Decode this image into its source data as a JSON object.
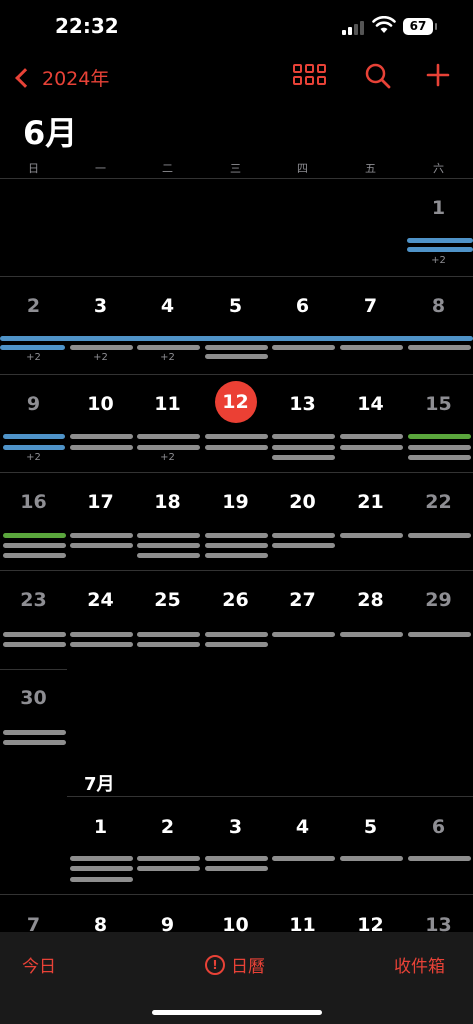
{
  "status": {
    "time": "22:32",
    "battery": "67"
  },
  "nav": {
    "back_label": "2024年"
  },
  "month_title": "6月",
  "weekdays": [
    "日",
    "一",
    "二",
    "三",
    "四",
    "五",
    "六"
  ],
  "june_weeks": [
    [
      "",
      "",
      "",
      "",
      "",
      "",
      "1"
    ],
    [
      "2",
      "3",
      "4",
      "5",
      "6",
      "7",
      "8"
    ],
    [
      "9",
      "10",
      "11",
      "12",
      "13",
      "14",
      "15"
    ],
    [
      "16",
      "17",
      "18",
      "19",
      "20",
      "21",
      "22"
    ],
    [
      "23",
      "24",
      "25",
      "26",
      "27",
      "28",
      "29"
    ],
    [
      "30",
      "",
      "",
      "",
      "",
      "",
      ""
    ]
  ],
  "today": "12",
  "more_label": "+2",
  "july": {
    "label": "7月",
    "weeks": [
      [
        "",
        "1",
        "2",
        "3",
        "4",
        "5",
        "6"
      ],
      [
        "7",
        "8",
        "9",
        "10",
        "11",
        "12",
        "13"
      ]
    ]
  },
  "toolbar": {
    "today": "今日",
    "calendars": "日曆",
    "inbox": "收件箱"
  },
  "colors": {
    "accent": "#e84237",
    "today": "#eb4034",
    "event_gray": "#8e8e8e",
    "event_blue": "#4f93c8",
    "event_green": "#5aa63c"
  }
}
